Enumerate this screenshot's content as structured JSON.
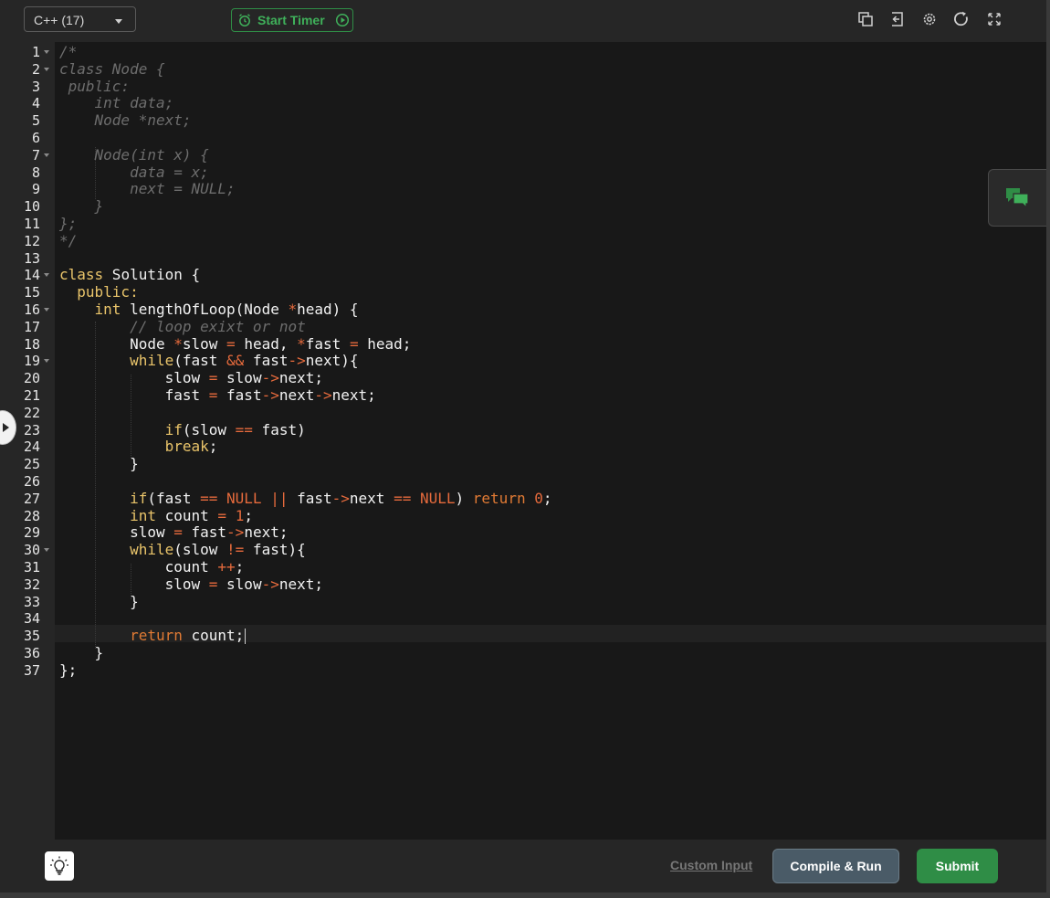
{
  "toolbar": {
    "language": "C++ (17)",
    "timer_label": "Start Timer",
    "icons": [
      "copy-icon",
      "exit-icon",
      "settings-icon",
      "reset-icon",
      "fullscreen-icon"
    ]
  },
  "editor": {
    "line_numbers": [
      "1",
      "2",
      "3",
      "4",
      "5",
      "6",
      "7",
      "8",
      "9",
      "10",
      "11",
      "12",
      "13",
      "14",
      "15",
      "16",
      "17",
      "18",
      "19",
      "20",
      "21",
      "22",
      "23",
      "24",
      "25",
      "26",
      "27",
      "28",
      "29",
      "30",
      "31",
      "32",
      "33",
      "34",
      "35",
      "36",
      "37"
    ],
    "fold_markers": [
      "1",
      "2",
      "7",
      "14",
      "16",
      "19",
      "30"
    ],
    "active_line": "35",
    "code_lines": [
      [
        {
          "t": "/*",
          "c": "cm"
        }
      ],
      [
        {
          "t": "class Node {",
          "c": "cm"
        }
      ],
      [
        {
          "t": " public:",
          "c": "cm"
        }
      ],
      [
        {
          "t": "    int data;",
          "c": "cm"
        }
      ],
      [
        {
          "t": "    Node *next;",
          "c": "cm"
        }
      ],
      [],
      [
        {
          "t": "    Node(int x) {",
          "c": "cm"
        }
      ],
      [
        {
          "t": "        data = x;",
          "c": "cm"
        }
      ],
      [
        {
          "t": "        next = NULL;",
          "c": "cm"
        }
      ],
      [
        {
          "t": "    }",
          "c": "cm"
        }
      ],
      [
        {
          "t": "};",
          "c": "cm"
        }
      ],
      [
        {
          "t": "*/",
          "c": "cm"
        }
      ],
      [],
      [
        {
          "t": "class",
          "c": "kw"
        },
        {
          "t": " Solution {",
          "c": "id"
        }
      ],
      [
        {
          "t": "  ",
          "c": "id"
        },
        {
          "t": "public:",
          "c": "kw"
        }
      ],
      [
        {
          "t": "    ",
          "c": "id"
        },
        {
          "t": "int",
          "c": "kw"
        },
        {
          "t": " lengthOfLoop(Node ",
          "c": "id"
        },
        {
          "t": "*",
          "c": "op"
        },
        {
          "t": "head) {",
          "c": "id"
        }
      ],
      [
        {
          "t": "        // loop exixt or not",
          "c": "cm"
        }
      ],
      [
        {
          "t": "        Node ",
          "c": "id"
        },
        {
          "t": "*",
          "c": "op"
        },
        {
          "t": "slow ",
          "c": "id"
        },
        {
          "t": "=",
          "c": "op"
        },
        {
          "t": " head, ",
          "c": "id"
        },
        {
          "t": "*",
          "c": "op"
        },
        {
          "t": "fast ",
          "c": "id"
        },
        {
          "t": "=",
          "c": "op"
        },
        {
          "t": " head;",
          "c": "id"
        }
      ],
      [
        {
          "t": "        ",
          "c": "id"
        },
        {
          "t": "while",
          "c": "kw"
        },
        {
          "t": "(fast ",
          "c": "id"
        },
        {
          "t": "&&",
          "c": "op"
        },
        {
          "t": " fast",
          "c": "id"
        },
        {
          "t": "->",
          "c": "op"
        },
        {
          "t": "next){",
          "c": "id"
        }
      ],
      [
        {
          "t": "            slow ",
          "c": "id"
        },
        {
          "t": "=",
          "c": "op"
        },
        {
          "t": " slow",
          "c": "id"
        },
        {
          "t": "->",
          "c": "op"
        },
        {
          "t": "next;",
          "c": "id"
        }
      ],
      [
        {
          "t": "            fast ",
          "c": "id"
        },
        {
          "t": "=",
          "c": "op"
        },
        {
          "t": " fast",
          "c": "id"
        },
        {
          "t": "->",
          "c": "op"
        },
        {
          "t": "next",
          "c": "id"
        },
        {
          "t": "->",
          "c": "op"
        },
        {
          "t": "next;",
          "c": "id"
        }
      ],
      [],
      [
        {
          "t": "            ",
          "c": "id"
        },
        {
          "t": "if",
          "c": "kw"
        },
        {
          "t": "(slow ",
          "c": "id"
        },
        {
          "t": "==",
          "c": "op"
        },
        {
          "t": " fast)",
          "c": "id"
        }
      ],
      [
        {
          "t": "            ",
          "c": "id"
        },
        {
          "t": "break",
          "c": "kw"
        },
        {
          "t": ";",
          "c": "id"
        }
      ],
      [
        {
          "t": "        }",
          "c": "id"
        }
      ],
      [],
      [
        {
          "t": "        ",
          "c": "id"
        },
        {
          "t": "if",
          "c": "kw"
        },
        {
          "t": "(fast ",
          "c": "id"
        },
        {
          "t": "==",
          "c": "op"
        },
        {
          "t": " ",
          "c": "id"
        },
        {
          "t": "NULL",
          "c": "nm"
        },
        {
          "t": " ",
          "c": "id"
        },
        {
          "t": "||",
          "c": "op"
        },
        {
          "t": " fast",
          "c": "id"
        },
        {
          "t": "->",
          "c": "op"
        },
        {
          "t": "next ",
          "c": "id"
        },
        {
          "t": "==",
          "c": "op"
        },
        {
          "t": " ",
          "c": "id"
        },
        {
          "t": "NULL",
          "c": "nm"
        },
        {
          "t": ") ",
          "c": "id"
        },
        {
          "t": "return",
          "c": "ret"
        },
        {
          "t": " ",
          "c": "id"
        },
        {
          "t": "0",
          "c": "nm"
        },
        {
          "t": ";",
          "c": "id"
        }
      ],
      [
        {
          "t": "        ",
          "c": "id"
        },
        {
          "t": "int",
          "c": "kw"
        },
        {
          "t": " count ",
          "c": "id"
        },
        {
          "t": "=",
          "c": "op"
        },
        {
          "t": " ",
          "c": "id"
        },
        {
          "t": "1",
          "c": "nm"
        },
        {
          "t": ";",
          "c": "id"
        }
      ],
      [
        {
          "t": "        slow ",
          "c": "id"
        },
        {
          "t": "=",
          "c": "op"
        },
        {
          "t": " fast",
          "c": "id"
        },
        {
          "t": "->",
          "c": "op"
        },
        {
          "t": "next;",
          "c": "id"
        }
      ],
      [
        {
          "t": "        ",
          "c": "id"
        },
        {
          "t": "while",
          "c": "kw"
        },
        {
          "t": "(slow ",
          "c": "id"
        },
        {
          "t": "!=",
          "c": "op"
        },
        {
          "t": " fast){",
          "c": "id"
        }
      ],
      [
        {
          "t": "            count ",
          "c": "id"
        },
        {
          "t": "++",
          "c": "op"
        },
        {
          "t": ";",
          "c": "id"
        }
      ],
      [
        {
          "t": "            slow ",
          "c": "id"
        },
        {
          "t": "=",
          "c": "op"
        },
        {
          "t": " slow",
          "c": "id"
        },
        {
          "t": "->",
          "c": "op"
        },
        {
          "t": "next;",
          "c": "id"
        }
      ],
      [
        {
          "t": "        }",
          "c": "id"
        }
      ],
      [],
      [
        {
          "t": "        ",
          "c": "id"
        },
        {
          "t": "return",
          "c": "ret"
        },
        {
          "t": " count;",
          "c": "id"
        }
      ],
      [
        {
          "t": "    }",
          "c": "id"
        }
      ],
      [
        {
          "t": "};",
          "c": "id"
        }
      ]
    ]
  },
  "footer": {
    "custom_input_label": "Custom Input",
    "compile_label": "Compile & Run",
    "submit_label": "Submit"
  },
  "colors": {
    "accent_green": "#2f8d46",
    "keyword": "#e9c46a",
    "operator": "#e56a3c",
    "comment": "#6d6d6d"
  }
}
